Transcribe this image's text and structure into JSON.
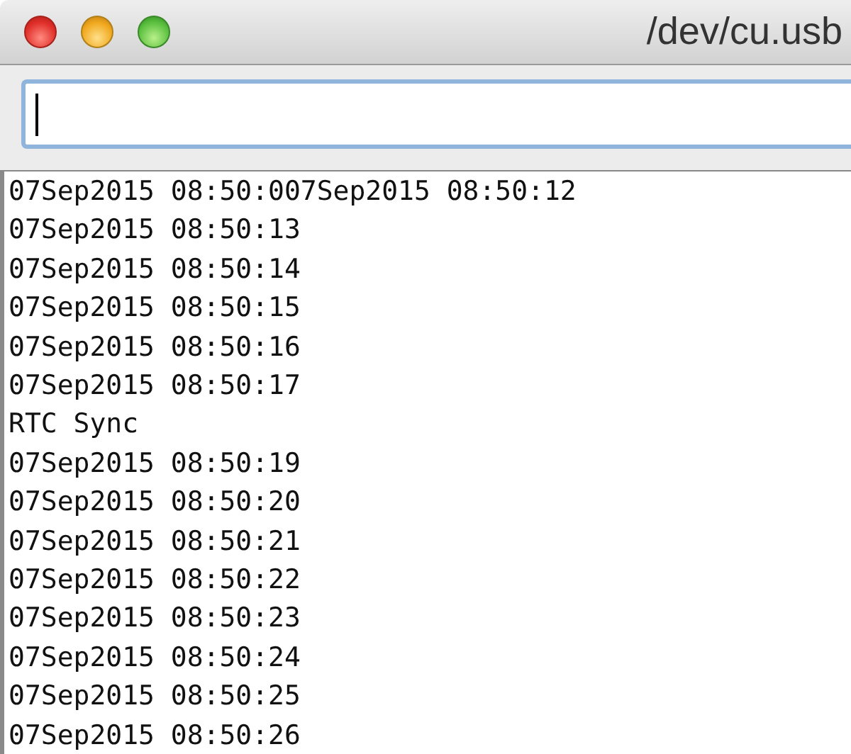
{
  "window": {
    "title": "/dev/cu.usb"
  },
  "input": {
    "focused": true
  },
  "output": {
    "lines": [
      "07Sep2015 08:50:007Sep2015 08:50:12",
      "07Sep2015 08:50:13",
      "07Sep2015 08:50:14",
      "07Sep2015 08:50:15",
      "07Sep2015 08:50:16",
      "07Sep2015 08:50:17",
      "RTC Sync",
      "07Sep2015 08:50:19",
      "07Sep2015 08:50:20",
      "07Sep2015 08:50:21",
      "07Sep2015 08:50:22",
      "07Sep2015 08:50:23",
      "07Sep2015 08:50:24",
      "07Sep2015 08:50:25",
      "07Sep2015 08:50:26"
    ]
  }
}
